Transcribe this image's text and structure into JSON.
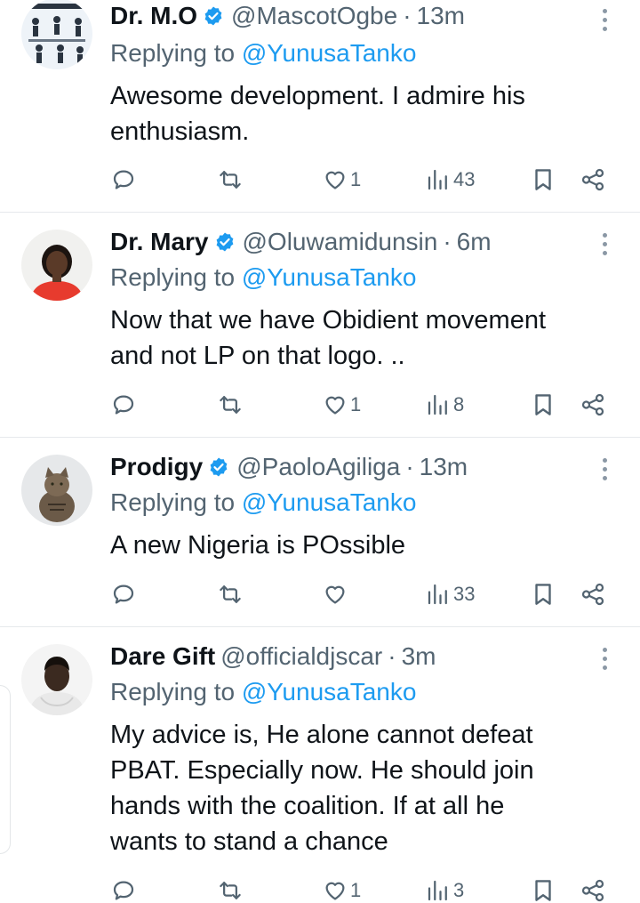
{
  "tweets": [
    {
      "name": "Dr. M.O",
      "verified": true,
      "handle": "@MascotOgbe",
      "time": "13m",
      "replying_label": "Replying to",
      "replying_to": "@YunusaTanko",
      "text_lines": [
        "Awesome development. I admire his",
        "enthusiasm."
      ],
      "replies": "",
      "reposts": "",
      "likes": "1",
      "views": "43"
    },
    {
      "name": "Dr. Mary",
      "verified": true,
      "handle": "@Oluwamidunsin",
      "time": "6m",
      "replying_label": "Replying to",
      "replying_to": "@YunusaTanko",
      "text_lines": [
        "Now that we have Obidient movement",
        "and not LP on that logo.  .."
      ],
      "replies": "",
      "reposts": "",
      "likes": "1",
      "views": "8"
    },
    {
      "name": "Prodigy",
      "verified": true,
      "handle": "@PaoloAgiliga",
      "time": "13m",
      "replying_label": "Replying to",
      "replying_to": "@YunusaTanko",
      "text_lines": [
        "A new Nigeria is POssible"
      ],
      "replies": "",
      "reposts": "",
      "likes": "",
      "views": "33"
    },
    {
      "name": "Dare Gift",
      "verified": false,
      "handle": "@officialdjscar",
      "time": "3m",
      "replying_label": "Replying to",
      "replying_to": "@YunusaTanko",
      "text_lines": [
        "My advice is, He alone cannot defeat",
        "PBAT. Especially now. He should join",
        "hands with the coalition. If at all he",
        "wants to stand a chance"
      ],
      "replies": "",
      "reposts": "",
      "likes": "1",
      "views": "3"
    }
  ],
  "separator": "·",
  "colors": {
    "text": "#0f1419",
    "secondary": "#536471",
    "accent": "#1d9bf0",
    "divider": "#e6e9ec"
  },
  "icons": {
    "reply": "speech-bubble-icon",
    "repost": "repost-arrows-icon",
    "like": "heart-icon",
    "views": "bar-chart-icon",
    "bookmark": "bookmark-icon",
    "share": "share-icon",
    "verified": "verified-badge-icon",
    "more": "more-vertical-icon"
  }
}
